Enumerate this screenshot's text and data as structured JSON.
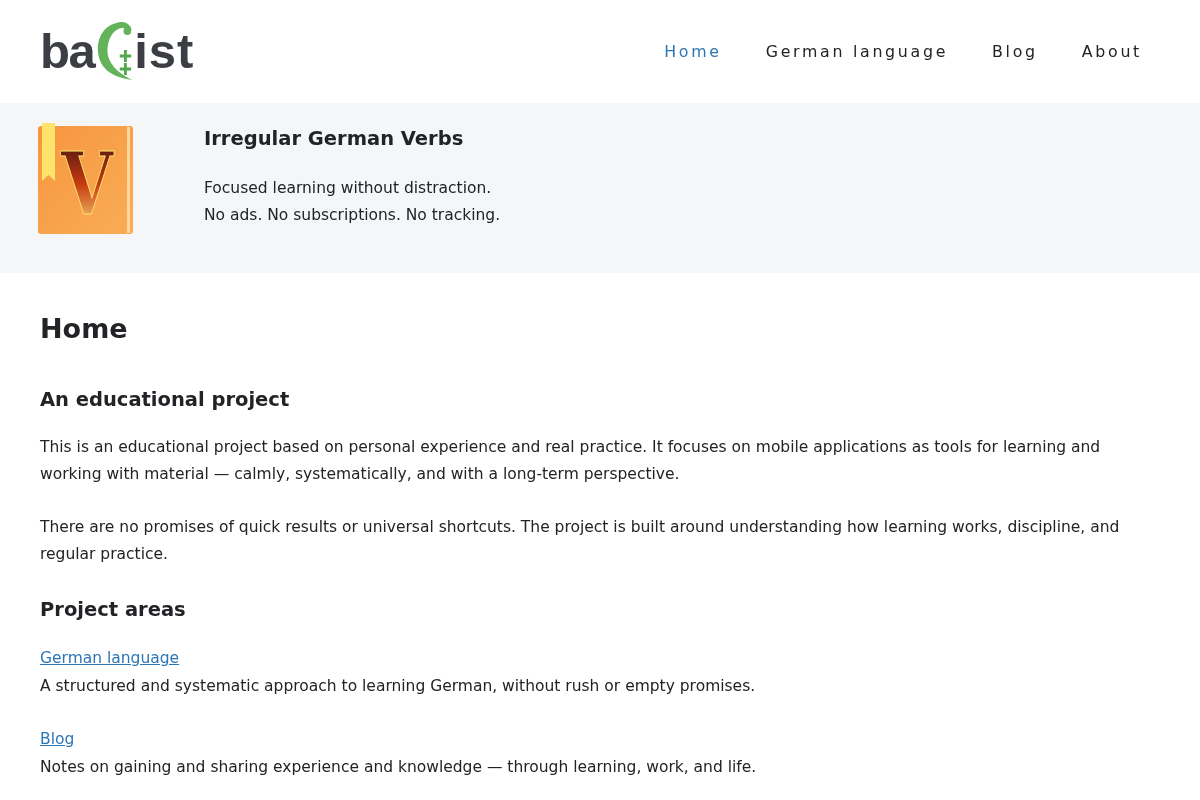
{
  "header": {
    "logo": {
      "text_before": "ba",
      "text_after": "ist"
    },
    "nav": [
      {
        "label": "Home",
        "selected": true
      },
      {
        "label": "German language",
        "selected": false
      },
      {
        "label": "Blog",
        "selected": false
      },
      {
        "label": "About",
        "selected": false
      }
    ]
  },
  "banner": {
    "icon_letter": "V",
    "title": "Irregular German Verbs",
    "lines": [
      "Focused learning without distraction.",
      "No ads. No subscriptions. No tracking."
    ]
  },
  "main": {
    "title": "Home",
    "sections": [
      {
        "heading": "An educational project",
        "paragraphs": [
          "This is an educational project based on personal experience and real practice. It focuses on mobile applications as tools for learning and working with material — calmly, systematically, and with a long-term perspective.",
          "There are no promises of quick results or universal shortcuts. The project is built around understanding how learning works, discipline, and regular practice."
        ]
      },
      {
        "heading": "Project areas",
        "links": [
          {
            "label": "German language",
            "description": "A structured and systematic approach to learning German, without rush or empty promises."
          },
          {
            "label": "Blog",
            "description": "Notes on gaining and sharing experience and knowledge — through learning, work, and life."
          }
        ]
      }
    ]
  }
}
